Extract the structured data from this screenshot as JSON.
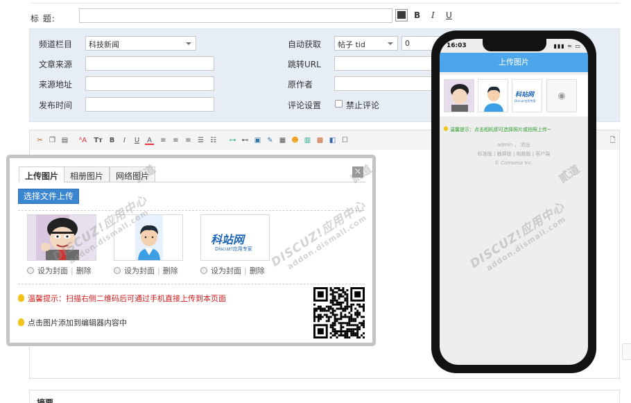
{
  "form": {
    "title_label": "标    题:",
    "bold_label": "B",
    "italic_label": "I",
    "underline_label": "U"
  },
  "meta": {
    "category_label": "频道栏目",
    "category_value": "科技新闻",
    "source_label": "文章来源",
    "source_url_label": "来源地址",
    "publish_time_label": "发布时间",
    "auto_fetch_label": "自动获取",
    "auto_fetch_value": "帖子 tid",
    "auto_fetch_id_value": "0",
    "jump_url_label": "跳转URL",
    "author_label": "原作者",
    "comment_setting_label": "评论设置",
    "disable_comment_label": "禁止评论"
  },
  "toolbar": {
    "icons": [
      "cut-icon",
      "copy-icon",
      "paste-icon",
      "font-size-icon",
      "heading-icon",
      "bold-icon",
      "italic-icon",
      "underline-icon",
      "font-color-icon",
      "align-left-icon",
      "align-center-icon",
      "align-right-icon",
      "ordered-list-icon",
      "unordered-list-icon",
      "link-icon",
      "unlink-icon",
      "image-icon",
      "attachment-icon",
      "media-icon",
      "smiley-icon",
      "table-icon",
      "gallery-icon",
      "code-icon",
      "checkbox-icon"
    ]
  },
  "dialog": {
    "tabs": [
      "上传图片",
      "相册图片",
      "网络图片"
    ],
    "close": "×",
    "upload_button": "选择文件上传",
    "thumbs": [
      {
        "name": "cartoon-avatar",
        "set_cover": "设为封面",
        "delete": "删除"
      },
      {
        "name": "person-avatar",
        "set_cover": "设为封面",
        "delete": "删除"
      },
      {
        "name": "kezhan-logo",
        "set_cover": "设为封面",
        "delete": "删除"
      }
    ],
    "logo_brand": "科站网",
    "logo_sub": "Discuz!应用专家",
    "tip_qr": "温馨提示：扫描右侧二维码后可通过手机直接上传到本页面",
    "tip_click": "点击图片添加到编辑器内容中"
  },
  "summary": {
    "label": "摘要"
  },
  "phone": {
    "time": "16:03",
    "status": "▮▮▮ ≈ ▭",
    "header": "上传图片",
    "camera": "◉",
    "tip": "温馨提示：点击相机即可选择照片或拍照上传~",
    "footer_user": "admin ， 退出",
    "footer_links": "标准版 | 触屏版 | 电脑版 | 客户端",
    "footer_copy": "© Comsenz Inc."
  },
  "watermark": {
    "brand": "DISCUZ!应用中心",
    "domain": "addon.dismall.com",
    "cn": "贰道"
  }
}
